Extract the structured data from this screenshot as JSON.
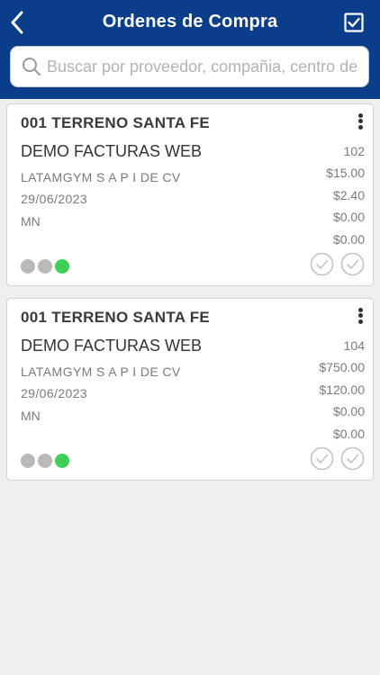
{
  "header": {
    "title": "Ordenes de Compra"
  },
  "search": {
    "placeholder": "Buscar por proveedor, compañia, centro de costo"
  },
  "colors": {
    "header_bg": "#0a3d8a",
    "status_gray": "#b9b9b9",
    "status_green": "#3fcf57"
  },
  "orders": [
    {
      "code": "001 TERRENO SANTA FE",
      "supplier": "DEMO FACTURAS WEB",
      "company": "LATAMGYM S A P I DE CV",
      "date": "29/06/2023",
      "currency": "MN",
      "number": "102",
      "amounts": [
        "$15.00",
        "$2.40",
        "$0.00",
        "$0.00"
      ],
      "status_dots": [
        "gray",
        "gray",
        "green"
      ]
    },
    {
      "code": "001 TERRENO SANTA FE",
      "supplier": "DEMO FACTURAS WEB",
      "company": "LATAMGYM S A P I DE CV",
      "date": "29/06/2023",
      "currency": "MN",
      "number": "104",
      "amounts": [
        "$750.00",
        "$120.00",
        "$0.00",
        "$0.00"
      ],
      "status_dots": [
        "gray",
        "gray",
        "green"
      ]
    }
  ]
}
